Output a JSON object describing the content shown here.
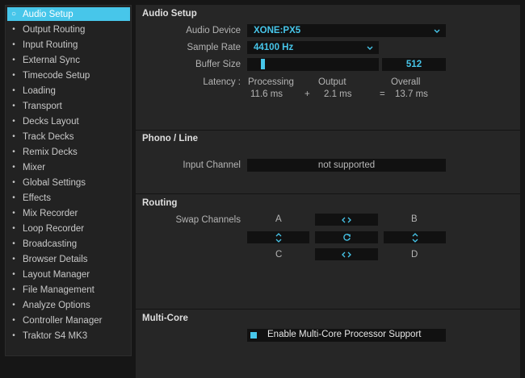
{
  "sidebar": {
    "items": [
      {
        "label": "Audio Setup",
        "active": true
      },
      {
        "label": "Output Routing"
      },
      {
        "label": "Input Routing"
      },
      {
        "label": "External Sync"
      },
      {
        "label": "Timecode Setup"
      },
      {
        "label": "Loading"
      },
      {
        "label": "Transport"
      },
      {
        "label": "Decks Layout"
      },
      {
        "label": "Track Decks"
      },
      {
        "label": "Remix Decks"
      },
      {
        "label": "Mixer"
      },
      {
        "label": "Global Settings"
      },
      {
        "label": "Effects"
      },
      {
        "label": "Mix Recorder"
      },
      {
        "label": "Loop Recorder"
      },
      {
        "label": "Broadcasting"
      },
      {
        "label": "Browser Details"
      },
      {
        "label": "Layout Manager"
      },
      {
        "label": "File Management"
      },
      {
        "label": "Analyze Options"
      },
      {
        "label": "Controller Manager"
      },
      {
        "label": "Traktor S4 MK3"
      }
    ]
  },
  "audio_setup": {
    "title": "Audio Setup",
    "audio_device_label": "Audio Device",
    "audio_device_value": "XONE:PX5",
    "sample_rate_label": "Sample Rate",
    "sample_rate_value": "44100 Hz",
    "buffer_size_label": "Buffer Size",
    "buffer_size_value": "512",
    "buffer_slider_fraction": 0.02,
    "latency_label": "Latency :",
    "processing_label": "Processing",
    "processing_value": "11.6 ms",
    "plus_sign": "+",
    "output_label": "Output",
    "output_value": "2.1 ms",
    "equals_sign": "=",
    "overall_label": "Overall",
    "overall_value": "13.7 ms"
  },
  "phono_line": {
    "title": "Phono / Line",
    "input_channel_label": "Input Channel",
    "input_channel_value": "not supported"
  },
  "routing": {
    "title": "Routing",
    "swap_channels_label": "Swap Channels",
    "deck_a": "A",
    "deck_b": "B",
    "deck_c": "C",
    "deck_d": "D"
  },
  "multi_core": {
    "title": "Multi-Core",
    "checkbox_label": "Enable Multi-Core Processor Support",
    "checked": true
  },
  "colors": {
    "accent": "#47c6ea",
    "panel_bg": "#262626",
    "field_bg": "#111111",
    "page_bg": "#161616"
  }
}
